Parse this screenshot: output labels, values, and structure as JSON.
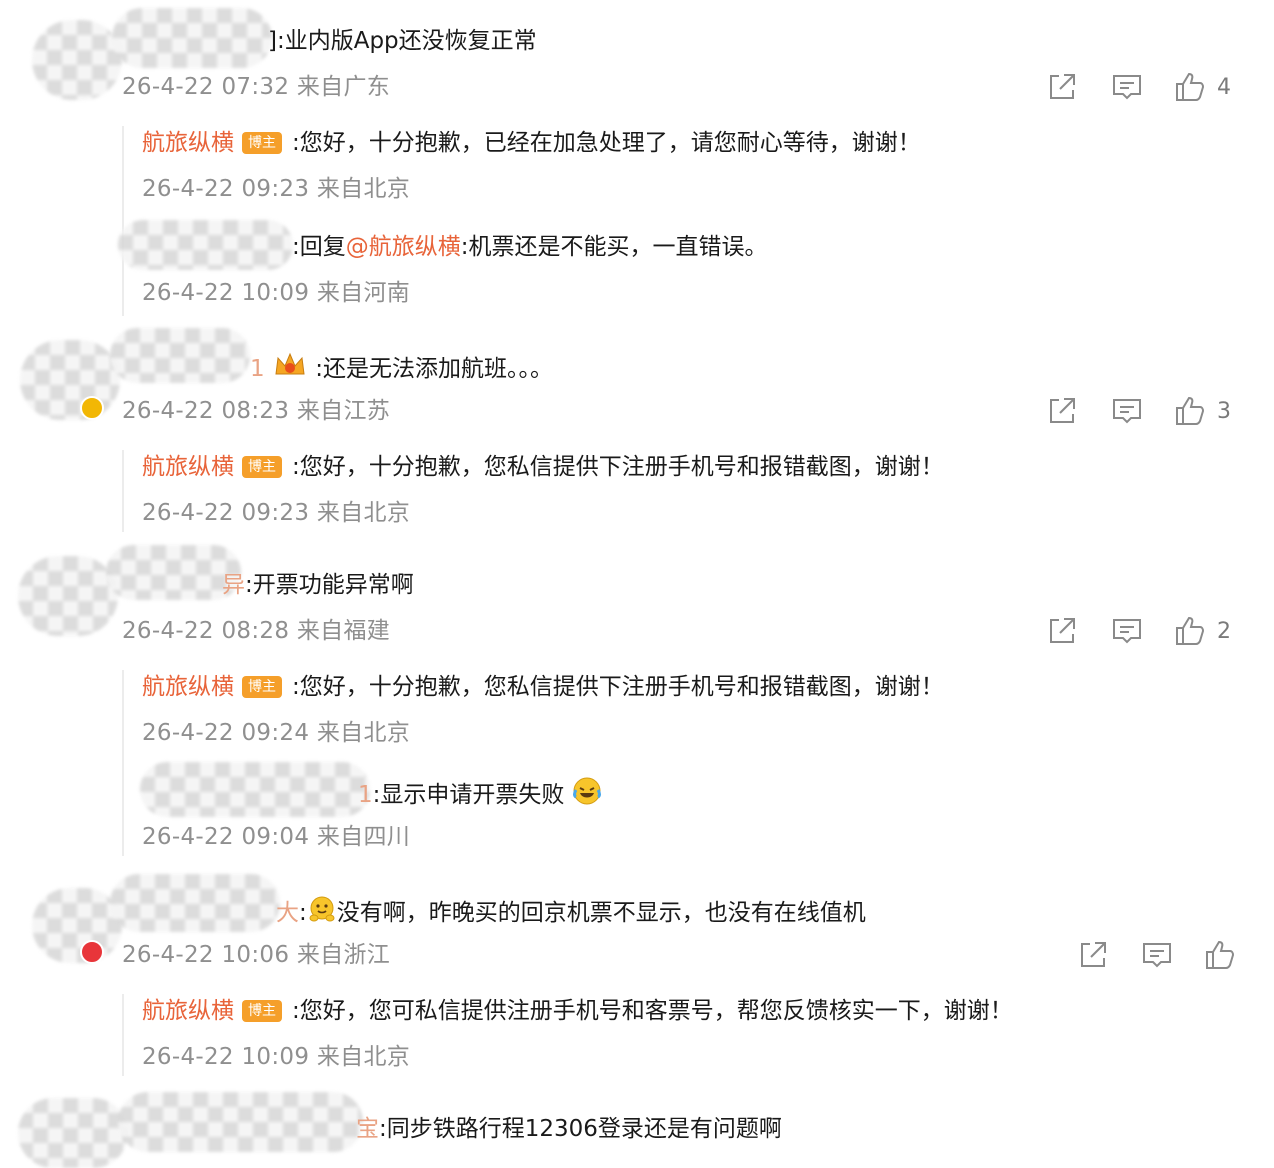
{
  "comments": [
    {
      "tail": "]:业内版App还没恢复正常",
      "meta": "26-4-22 07:32 来自广东",
      "likes": "4",
      "replies": [
        {
          "author": "航旅纵横",
          "tag": "博主",
          "text": ":您好，十分抱歉，已经在加急处理了，请您耐心等待，谢谢！",
          "meta": "26-4-22 09:23 来自北京"
        },
        {
          "prefix": ":回复",
          "mention": "@航旅纵横",
          "text": ":机票还是不能买，一直错误。",
          "meta": "26-4-22 10:09 来自河南"
        }
      ]
    },
    {
      "tail_num": "1",
      "tail": ":还是无法添加航班。。。",
      "meta": "26-4-22 08:23 来自江苏",
      "likes": "3",
      "replies": [
        {
          "author": "航旅纵横",
          "tag": "博主",
          "text": ":您好，十分抱歉，您私信提供下注册手机号和报错截图，谢谢！",
          "meta": "26-4-22 09:23 来自北京"
        }
      ]
    },
    {
      "tail_char": "异",
      "tail": ":开票功能异常啊",
      "meta": "26-4-22 08:28 来自福建",
      "likes": "2",
      "replies": [
        {
          "author": "航旅纵横",
          "tag": "博主",
          "text": ":您好，十分抱歉，您私信提供下注册手机号和报错截图，谢谢！",
          "meta": "26-4-22 09:24 来自北京"
        },
        {
          "tail_num": "1",
          "text": ":显示申请开票失败",
          "meta": "26-4-22 09:04 来自四川"
        }
      ]
    },
    {
      "tail_char": "大",
      "tail": "没有啊，昨晚买的回京机票不显示，也没有在线值机",
      "meta": "26-4-22 10:06 来自浙江",
      "replies": [
        {
          "author": "航旅纵横",
          "tag": "博主",
          "text": ":您好，您可私信提供注册手机号和客票号，帮您反馈核实一下，谢谢！",
          "meta": "26-4-22 10:09 来自北京"
        }
      ]
    },
    {
      "tail_char": "宝",
      "tail": ":同步铁路行程12306登录还是有问题啊"
    }
  ],
  "icons": {
    "share": "share-icon",
    "comment": "comment-icon",
    "like": "thumbs-up-icon"
  },
  "colors": {
    "author": "#e8643a",
    "tag_bg": "#f59f2a",
    "meta": "#8f8f8f"
  }
}
